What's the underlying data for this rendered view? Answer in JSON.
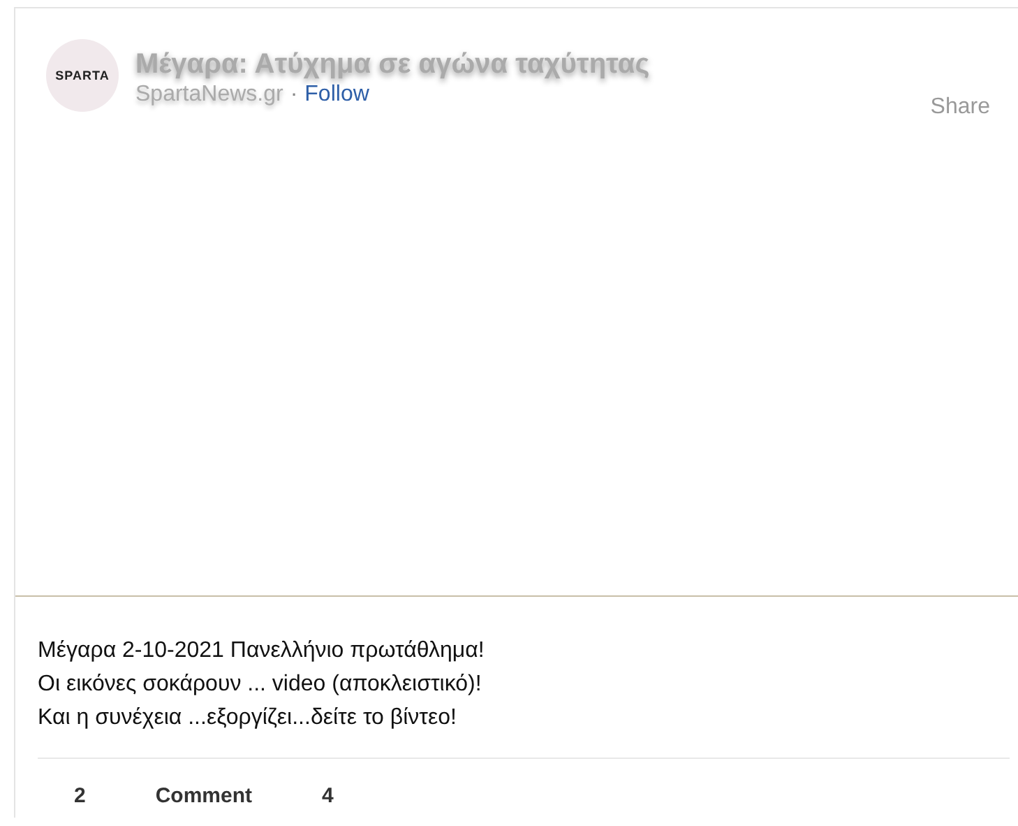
{
  "post": {
    "avatar_text": "SPARTA",
    "title": "Μέγαρα: Ατύχημα σε αγώνα ταχύτητας",
    "source": "SpartaNews.gr",
    "separator": "·",
    "follow": "Follow",
    "share": "Share"
  },
  "body": [
    "Μέγαρα 2-10-2021 Πανελλήνιο πρωτάθλημα!",
    "Οι εικόνες σοκάρουν ... video (αποκλειστικό)!",
    "Και η συνέχεια ...εξοργίζει...δείτε το βίντεο!"
  ],
  "footer": [
    "2",
    "Comment",
    "4"
  ]
}
